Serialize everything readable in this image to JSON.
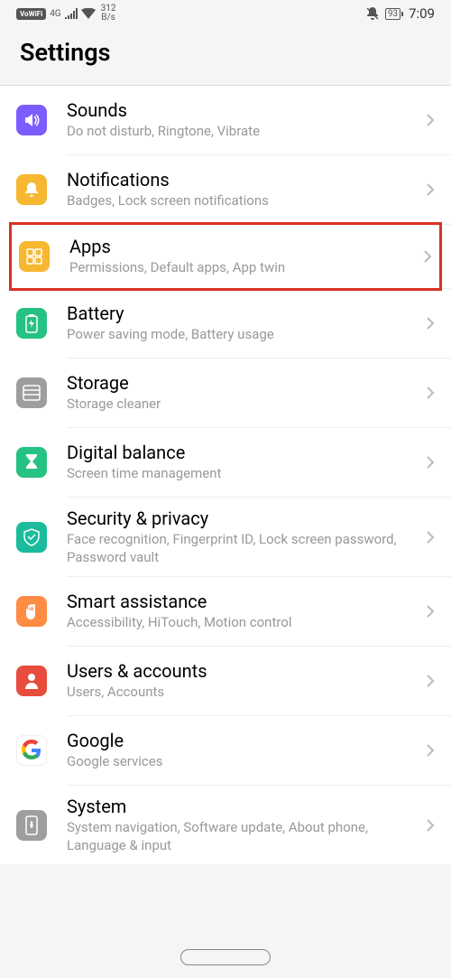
{
  "status": {
    "vowifi": "VoWiFi",
    "network": "4G",
    "speed1": "312",
    "speed2": "B/s",
    "battery": "93",
    "time": "7:09"
  },
  "header": {
    "title": "Settings"
  },
  "rows": [
    {
      "title": "Sounds",
      "sub": "Do not disturb, Ringtone, Vibrate"
    },
    {
      "title": "Notifications",
      "sub": "Badges, Lock screen notifications"
    },
    {
      "title": "Apps",
      "sub": "Permissions, Default apps, App twin"
    },
    {
      "title": "Battery",
      "sub": "Power saving mode, Battery usage"
    },
    {
      "title": "Storage",
      "sub": "Storage cleaner"
    },
    {
      "title": "Digital balance",
      "sub": "Screen time management"
    },
    {
      "title": "Security & privacy",
      "sub": "Face recognition, Fingerprint ID, Lock screen password, Password vault"
    },
    {
      "title": "Smart assistance",
      "sub": "Accessibility, HiTouch, Motion control"
    },
    {
      "title": "Users & accounts",
      "sub": "Users, Accounts"
    },
    {
      "title": "Google",
      "sub": "Google services"
    },
    {
      "title": "System",
      "sub": "System navigation, Software update, About phone, Language & input"
    }
  ]
}
